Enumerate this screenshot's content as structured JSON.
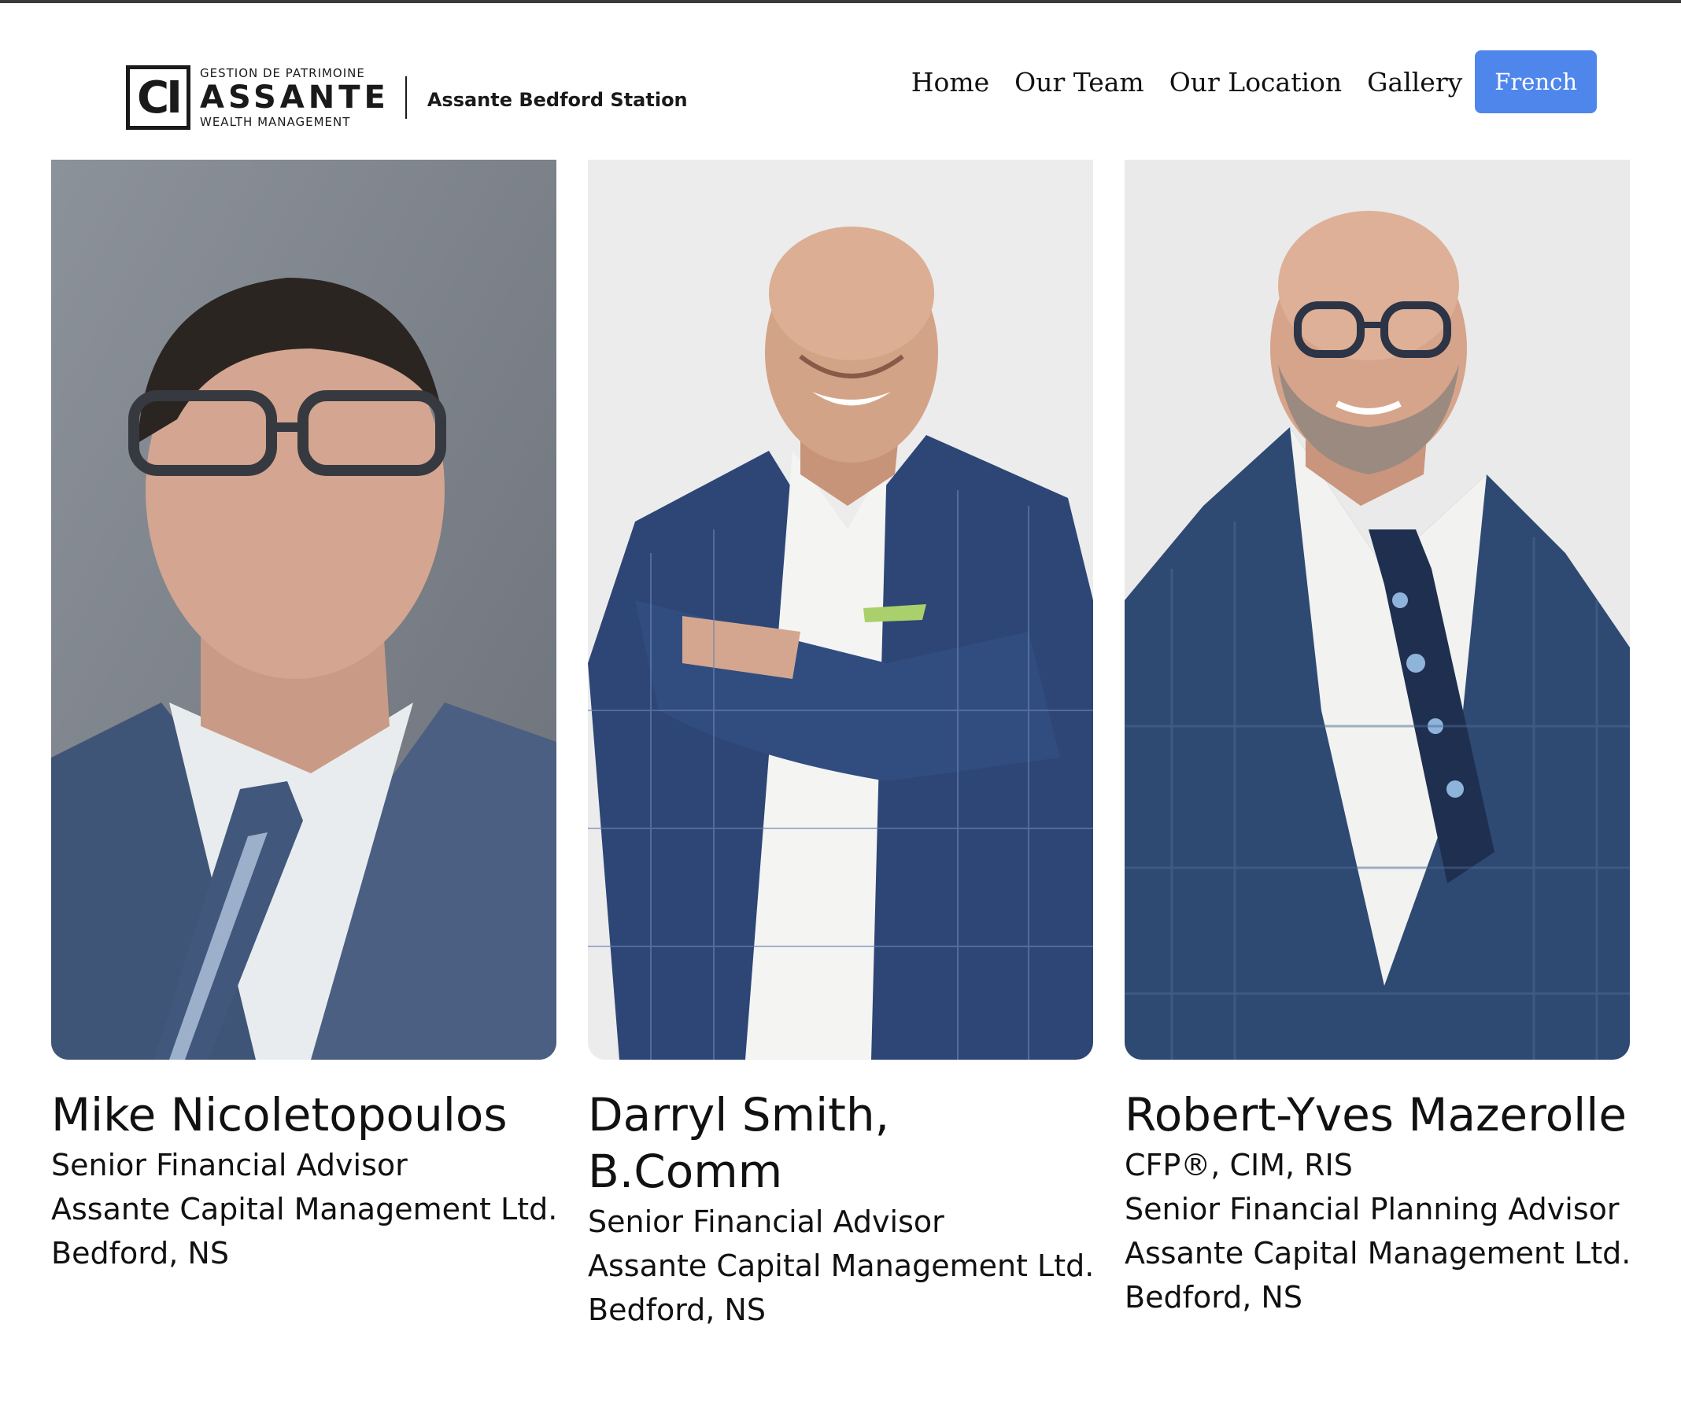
{
  "header": {
    "logo": {
      "mark": "CI",
      "tag_top": "GESTION DE PATRIMOINE",
      "wordmark": "ASSANTE",
      "tag_bottom": "WEALTH MANAGEMENT",
      "branch": "Assante Bedford Station"
    },
    "nav": {
      "home": "Home",
      "team": "Our Team",
      "location": "Our Location",
      "gallery": "Gallery",
      "language_button": "French"
    },
    "accent_color": "#4f86ec"
  },
  "team": [
    {
      "name": "Mike Nicoletopoulos",
      "lines": [
        "Senior Financial Advisor",
        "Assante Capital Management Ltd.",
        "Bedford, NS"
      ]
    },
    {
      "name": "Darryl Smith, B.Comm",
      "lines": [
        "Senior Financial Advisor",
        "Assante Capital Management Ltd.",
        "Bedford, NS"
      ]
    },
    {
      "name": "Robert-Yves Mazerolle",
      "lines": [
        "CFP®, CIM, RIS",
        "Senior Financial Planning Advisor",
        "Assante Capital Management Ltd.",
        "Bedford, NS"
      ]
    }
  ]
}
